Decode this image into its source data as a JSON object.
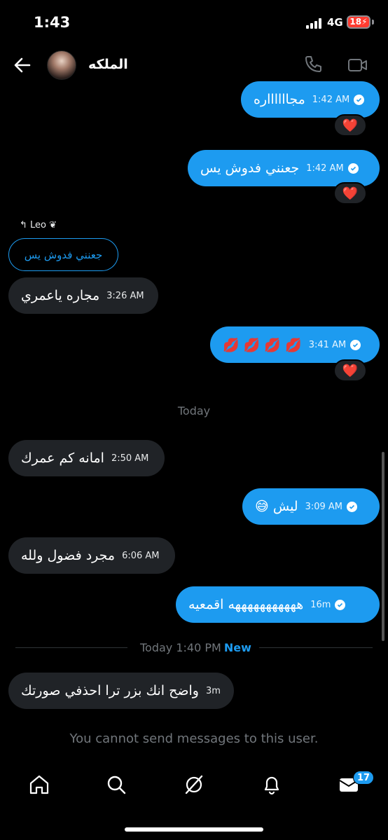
{
  "status_bar": {
    "time": "1:43",
    "network": "4G",
    "battery": "18"
  },
  "header": {
    "contact_name": "الملكه"
  },
  "messages": [
    {
      "text": "مجااااااره",
      "time": "1:42 AM",
      "reaction": "❤️"
    },
    {
      "text": "جعنني فدوش يس",
      "time": "1:42 AM",
      "reaction": "❤️"
    },
    {
      "reply_to": "Leo ❦",
      "quoted": "جعنني فدوش يس",
      "text": "مجاره ياعمري",
      "time": "3:26 AM"
    },
    {
      "text": "💋 💋 💋 💋",
      "time": "3:41 AM",
      "reaction": "❤️"
    },
    {
      "text": "امانه كم عمرك",
      "time": "2:50 AM"
    },
    {
      "text": "ليش 😅",
      "time": "3:09 AM"
    },
    {
      "text": "مجرد فضول ولله",
      "time": "6:06 AM"
    },
    {
      "text": "هههههههههههه اقمعيه",
      "time": "16m"
    },
    {
      "text": "واضح انك بزر ترا احذفي صورتك",
      "time": "3m"
    }
  ],
  "separators": {
    "today": "Today",
    "new_time": "Today 1:40 PM",
    "new_label": "New"
  },
  "blocked_notice": "You cannot send messages to this user.",
  "tabbar": {
    "messages_badge": "17"
  }
}
